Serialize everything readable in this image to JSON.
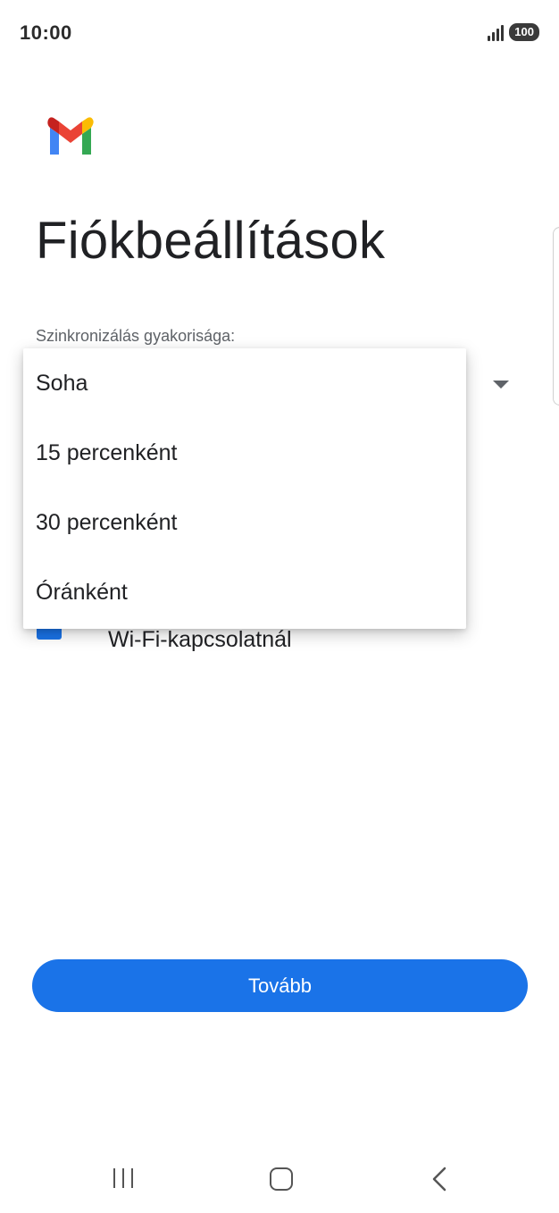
{
  "status_bar": {
    "time": "10:00",
    "battery": "100"
  },
  "page": {
    "title": "Fiókbeállítások",
    "sync_label": "Szinkronizálás gyakorisága:",
    "wifi_option_label": "Wi-Fi-kapcsolatnál",
    "wifi_option_checked": true
  },
  "dropdown": {
    "options": [
      "Soha",
      "15 percenként",
      "30 percenként",
      "Óránként"
    ]
  },
  "actions": {
    "next_label": "Tovább"
  },
  "colors": {
    "primary": "#1a73e8",
    "text": "#202124",
    "secondary_text": "#5f6368"
  },
  "icons": {
    "logo": "gmail-logo",
    "signal": "signal-icon",
    "battery": "battery-icon",
    "nav_recent": "recent-apps-icon",
    "nav_home": "home-icon",
    "nav_back": "back-icon"
  }
}
